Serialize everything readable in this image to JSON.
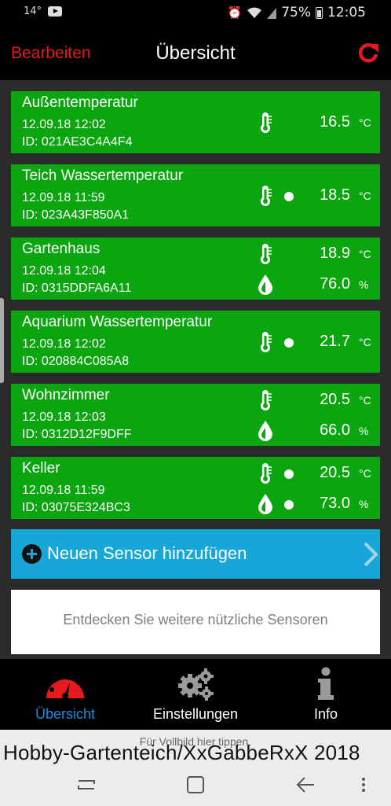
{
  "status_bar": {
    "temperature": "14°",
    "battery": "75%",
    "time": "12:05"
  },
  "header": {
    "edit_label": "Bearbeiten",
    "title": "Übersicht"
  },
  "sensors": [
    {
      "name": "Außentemperatur",
      "date": "12.09.18  12:02",
      "id": "ID: 021AE3C4A4F4",
      "readings": [
        {
          "icon": "thermometer-icon",
          "dot": false,
          "value": "16.5",
          "unit": "°C"
        }
      ]
    },
    {
      "name": "Teich Wassertemperatur",
      "date": "12.09.18  11:59",
      "id": "ID: 023A43F850A1",
      "readings": [
        {
          "icon": "thermometer-icon",
          "dot": true,
          "value": "18.5",
          "unit": "°C"
        }
      ]
    },
    {
      "name": "Gartenhaus",
      "date": "12.09.18  12:04",
      "id": "ID: 0315DDFA6A11",
      "readings": [
        {
          "icon": "thermometer-icon",
          "dot": false,
          "value": "18.9",
          "unit": "°C"
        },
        {
          "icon": "humidity-drop-icon",
          "dot": false,
          "value": "76.0",
          "unit": "%"
        }
      ]
    },
    {
      "name": "Aquarium Wassertemperatur",
      "date": "12.09.18  12:02",
      "id": "ID: 020884C085A8",
      "readings": [
        {
          "icon": "thermometer-icon",
          "dot": true,
          "value": "21.7",
          "unit": "°C"
        }
      ]
    },
    {
      "name": "Wohnzimmer",
      "date": "12.09.18  12:03",
      "id": "ID: 0312D12F9DFF",
      "readings": [
        {
          "icon": "thermometer-icon",
          "dot": false,
          "value": "20.5",
          "unit": "°C"
        },
        {
          "icon": "humidity-drop-icon",
          "dot": false,
          "value": "66.0",
          "unit": "%"
        }
      ]
    },
    {
      "name": "Keller",
      "date": "12.09.18  11:59",
      "id": "ID: 03075E324BC3",
      "readings": [
        {
          "icon": "thermometer-icon",
          "dot": true,
          "value": "20.5",
          "unit": "°C"
        },
        {
          "icon": "humidity-drop-icon",
          "dot": true,
          "value": "73.0",
          "unit": "%"
        }
      ]
    }
  ],
  "add_sensor_label": "Neuen Sensor hinzufügen",
  "discover_label": "Entdecken Sie weitere nützliche Sensoren",
  "tabs": [
    {
      "label": "Übersicht",
      "icon": "gauge-icon",
      "active": true
    },
    {
      "label": "Einstellungen",
      "icon": "gears-icon",
      "active": false
    },
    {
      "label": "Info",
      "icon": "info-icon",
      "active": false
    }
  ],
  "fullscreen_hint": "Für Vollbild hier tippen.",
  "watermark": "Hobby-Gartenteich/XxGabbeRxX 2018",
  "colors": {
    "card_green": "#0aa50f",
    "accent_red": "#e8191c",
    "add_bar_blue": "#16a7d8",
    "active_tab_blue": "#1a8fe0"
  }
}
